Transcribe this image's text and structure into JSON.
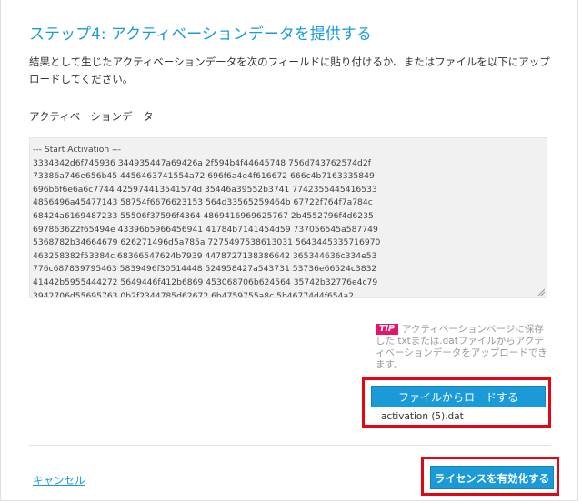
{
  "step": {
    "title": "ステップ4: アクティベーションデータを提供する",
    "description": "結果として生じたアクティベーションデータを次のフィールドに貼り付けるか、またはファイルを以下にアップロードしてください。"
  },
  "activation_field": {
    "label": "アクティベーションデータ",
    "value": "--- Start Activation ---\n3334342d6f745936 344935447a69426a 2f594b4f44645748 756d743762574d2f\n73386a746e656b45 4456463741554a72 696f6a4e4f616672 666c4b7163335849\n696b6f6e6a6c7744 425974413541574d 35446a39552b3741 7742355445416533\n4856496a45477143 58754f6676623153 564d33565259464b 67722f764f7a784c\n68424a6169487233 55506f37596f4364 4869416969625767 2b4552796f4d6235\n697863622f65494e 43396b5966456941 41784b7141454d59 737056545a587749\n5368782b34664679 626271496d5a785a 7275497538613031 5643445335716970\n463258382f53384c 68366547624b7939 4478727138386642 365344636c334e53\n776c687839795463 5839496f30514448 524958427a543731 53736e66524c3832\n41442b5955444272 5649446f412b6869 453068706b624564 35742b32776e4c79\n3942706d55695763 0b2f2344785d62672 6b4759755a8c 5b46774d4f654a2"
  },
  "tip": {
    "badge": "TIP",
    "text": "アクティベーションページに保存した.txtまたは.datファイルからアクティベーションデータをアップロードできます。"
  },
  "load_file": {
    "button_label": "ファイルからロードする",
    "file_name": "activation (5).dat"
  },
  "footer": {
    "cancel_label": "キャンセル",
    "activate_label": "ライセンスを有効化する"
  },
  "colors": {
    "accent": "#1a9bd7",
    "highlight_border": "#e30613",
    "tip_badge": "#e2146b"
  }
}
